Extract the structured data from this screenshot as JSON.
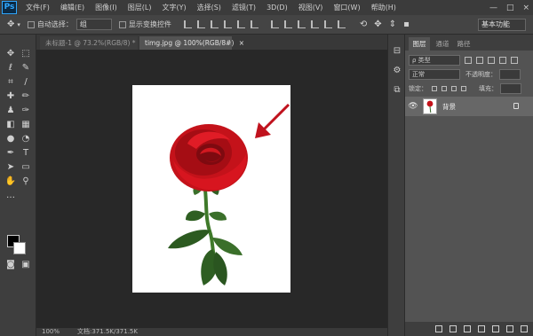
{
  "app": {
    "logo": "Ps"
  },
  "menu": [
    "文件(F)",
    "编辑(E)",
    "图像(I)",
    "图层(L)",
    "文字(Y)",
    "选择(S)",
    "滤镜(T)",
    "3D(D)",
    "视图(V)",
    "窗口(W)",
    "帮助(H)"
  ],
  "window_controls": {
    "minimize": "—",
    "maximize": "□",
    "close": "×"
  },
  "options": {
    "auto_select_label": "自动选择：",
    "auto_select_value": "组",
    "transform_label": "显示变换控件",
    "workspace": "基本功能"
  },
  "tabs": [
    {
      "label": "未标题-1 @ 73.2%(RGB/8) *",
      "close": "×"
    },
    {
      "label": "timg.jpg @ 100%(RGB/8#)",
      "close": "×"
    }
  ],
  "status": {
    "zoom": "100%",
    "doc": "文档:371.5K/371.5K"
  },
  "layers_panel": {
    "tabs": [
      "图层",
      "通道",
      "路径"
    ],
    "kind_filter": "ρ 类型",
    "blend_mode": "正常",
    "opacity_label": "不透明度：",
    "lock_label": "锁定：",
    "fill_label": "填充：",
    "layer_name": "背景"
  },
  "colors": {
    "foreground": "#000000",
    "background": "#ffffff",
    "canvas_bg": "#282828",
    "arrow": "#c0121d"
  }
}
